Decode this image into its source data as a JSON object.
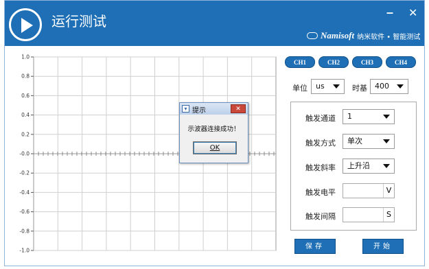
{
  "window": {
    "title": "运行测试",
    "minimize_label": "–",
    "close_label": "✕",
    "brand_logo": "Namisoft",
    "brand_text": "纳米软件 • 智能测试",
    "accent_color": "#1e6fb5"
  },
  "channels": [
    "CH1",
    "CH2",
    "CH3",
    "CH4"
  ],
  "settings": {
    "unit_label": "单位",
    "unit_value": "us",
    "timebase_label": "时基",
    "timebase_value": "400"
  },
  "trigger": {
    "channel_label": "触发通道",
    "channel_value": "1",
    "mode_label": "触发方式",
    "mode_value": "单次",
    "slope_label": "触发斜率",
    "slope_value": "上升沿",
    "level_label": "触发电平",
    "level_value": "",
    "level_unit": "V",
    "interval_label": "触发间隔",
    "interval_value": "",
    "interval_unit": "S"
  },
  "actions": {
    "save_label": "保存",
    "start_label": "开始"
  },
  "dialog": {
    "title": "提示",
    "message": "示波器连接成功！",
    "ok_label": "OK",
    "close_label": "✕"
  },
  "chart_data": {
    "type": "line",
    "title": "",
    "xlabel": "",
    "ylabel": "",
    "ylim": [
      -1.0,
      1.0
    ],
    "yticks": [
      "1.0",
      "0.8",
      "0.6",
      "0.4",
      "0.2",
      "-0.0",
      "-0.2",
      "-0.4",
      "-0.6",
      "-0.8",
      "-1.0"
    ],
    "grid": true,
    "series": []
  }
}
